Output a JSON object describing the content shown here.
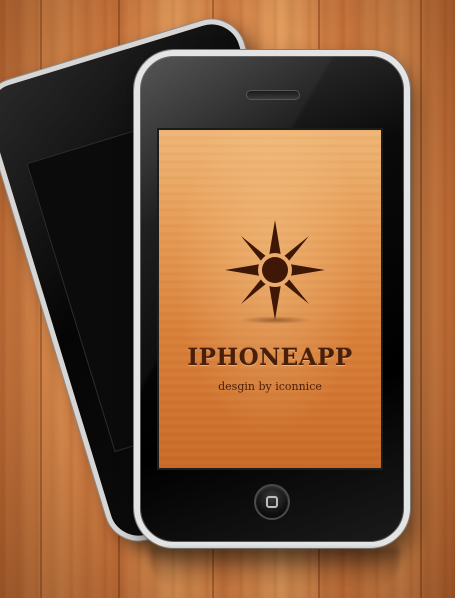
{
  "scene": {
    "background": "wood",
    "accent_color": "#4a1f0a",
    "screen_color": "#e69b55",
    "phone_bezel_color": "#e4e4e4"
  },
  "front_phone": {
    "screen": {
      "logo_icon": "sun-icon",
      "app_title": "IPHONEAPP",
      "app_subtitle": "desgin by iconnice"
    },
    "home_button_icon": "home-square-icon"
  },
  "back_phone": {
    "screen": "blank-dark"
  }
}
